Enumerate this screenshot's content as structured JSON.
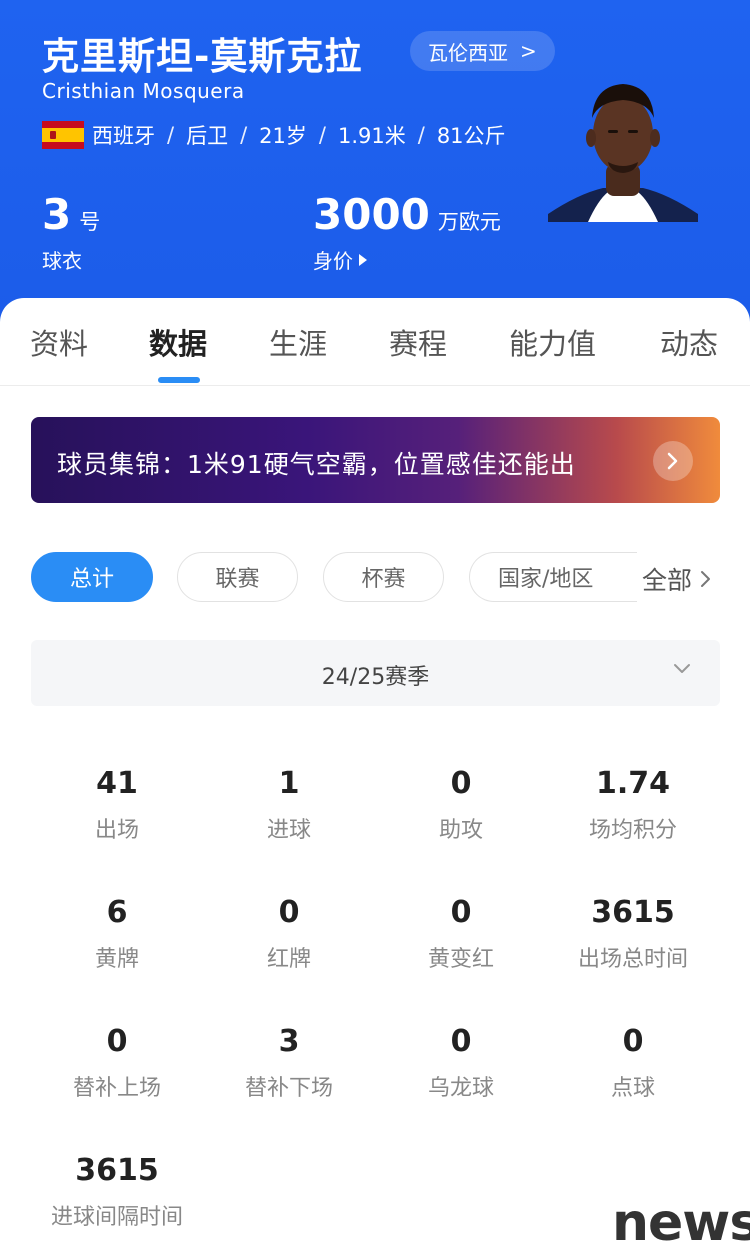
{
  "header": {
    "name_cn": "克里斯坦-莫斯克拉",
    "club": "瓦伦西亚",
    "club_arrow": ">",
    "name_en": "Cristhian  Mosquera",
    "nationality": "西班牙",
    "position": "后卫",
    "age": "21岁",
    "height": "1.91米",
    "weight": "81公斤",
    "shirt_number": "3",
    "shirt_unit": "号",
    "shirt_label": "球衣",
    "market_value": "3000",
    "market_value_unit": "万欧元",
    "market_value_label": "身价",
    "separator": "/"
  },
  "tabs": [
    {
      "label": "资料"
    },
    {
      "label": "数据"
    },
    {
      "label": "生涯"
    },
    {
      "label": "赛程"
    },
    {
      "label": "能力值"
    },
    {
      "label": "动态"
    }
  ],
  "active_tab": "数据",
  "banner": {
    "text": "球员集锦：1米91硬气空霸，位置感佳还能出"
  },
  "filters": {
    "chips": [
      "总计",
      "联赛",
      "杯赛",
      "国家/地区"
    ],
    "active": "总计",
    "all_label": "全部"
  },
  "season": {
    "label": "24/25赛季"
  },
  "stats": [
    {
      "value": "41",
      "label": "出场"
    },
    {
      "value": "1",
      "label": "进球"
    },
    {
      "value": "0",
      "label": "助攻"
    },
    {
      "value": "1.74",
      "label": "场均积分"
    },
    {
      "value": "6",
      "label": "黄牌"
    },
    {
      "value": "0",
      "label": "红牌"
    },
    {
      "value": "0",
      "label": "黄变红"
    },
    {
      "value": "3615",
      "label": "出场总时间"
    },
    {
      "value": "0",
      "label": "替补上场"
    },
    {
      "value": "3",
      "label": "替补下场"
    },
    {
      "value": "0",
      "label": "乌龙球"
    },
    {
      "value": "0",
      "label": "点球"
    },
    {
      "value": "3615",
      "label": "进球间隔时间"
    }
  ],
  "watermark": "news",
  "colors": {
    "header_blue": "#1f63f0",
    "accent_blue": "#2a8df5"
  }
}
